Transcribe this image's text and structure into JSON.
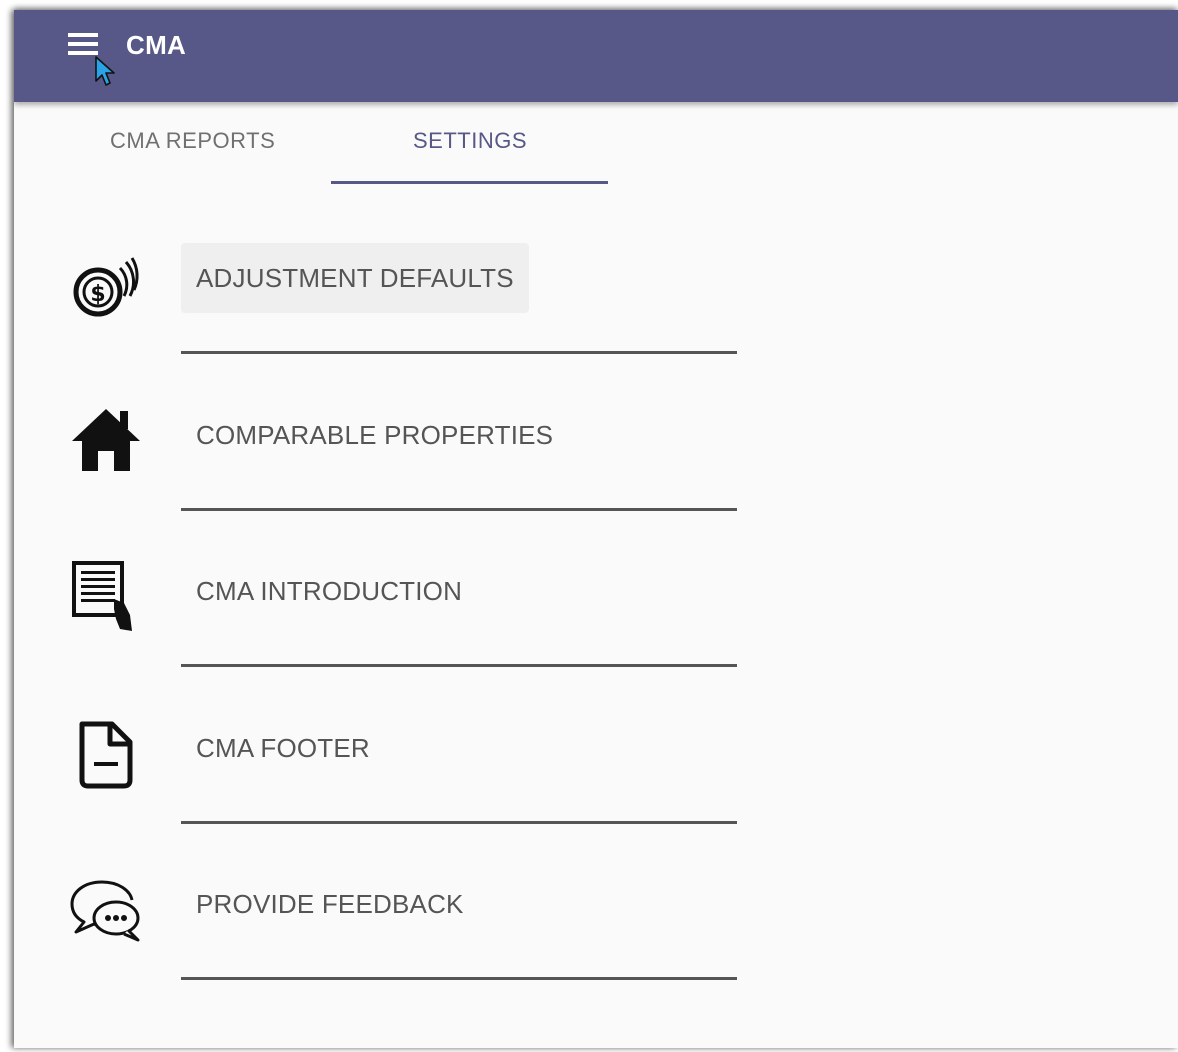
{
  "app": {
    "title": "CMA",
    "header_color": "#585888"
  },
  "header": {
    "menu_icon": "hamburger-menu-icon"
  },
  "tabs": [
    {
      "label": "CMA REPORTS",
      "selected": false
    },
    {
      "label": "SETTINGS",
      "selected": true
    }
  ],
  "settings": {
    "items": [
      {
        "label": "ADJUSTMENT DEFAULTS",
        "icon": "dollar-coin-icon",
        "highlighted": true
      },
      {
        "label": "COMPARABLE PROPERTIES",
        "icon": "house-icon",
        "highlighted": false
      },
      {
        "label": "CMA INTRODUCTION",
        "icon": "document-hand-icon",
        "highlighted": false
      },
      {
        "label": "CMA FOOTER",
        "icon": "document-minus-icon",
        "highlighted": false
      },
      {
        "label": "PROVIDE FEEDBACK",
        "icon": "chat-bubbles-icon",
        "highlighted": false
      }
    ]
  }
}
